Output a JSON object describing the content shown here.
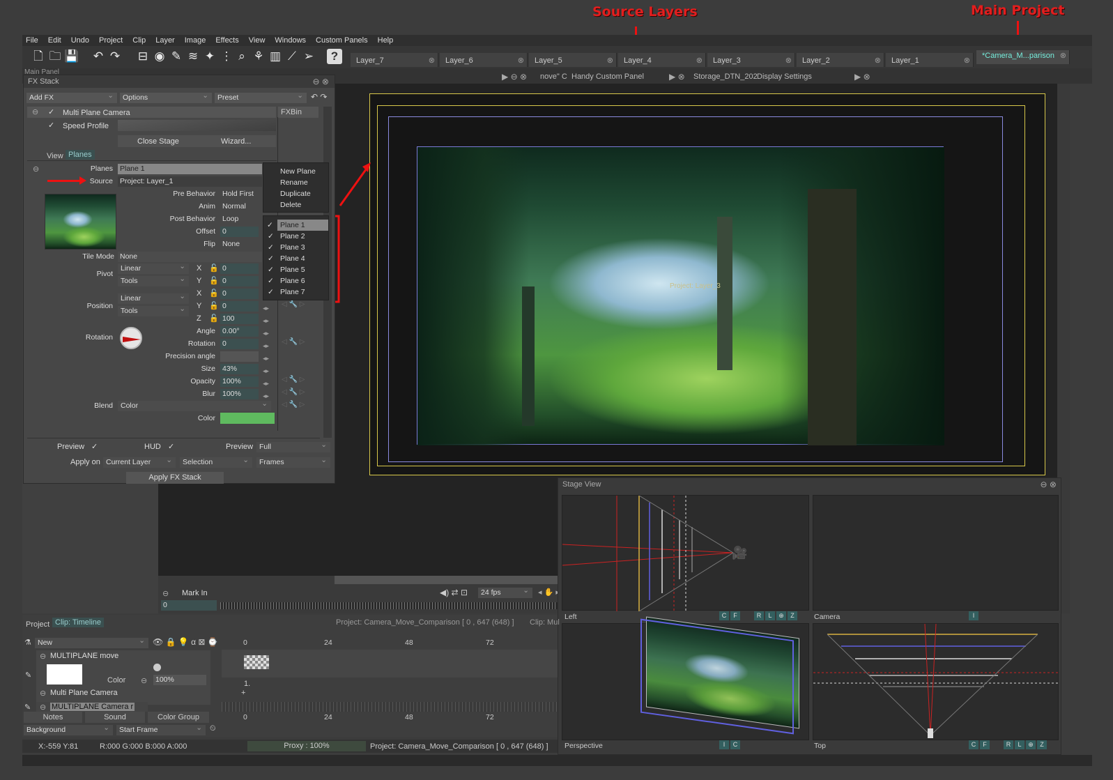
{
  "annotations": {
    "source_layers": "Source Layers",
    "main_project": "Main Project"
  },
  "menu": [
    "File",
    "Edit",
    "Undo",
    "Project",
    "Clip",
    "Layer",
    "Image",
    "Effects",
    "View",
    "Windows",
    "Custom Panels",
    "Help"
  ],
  "layer_tabs": [
    "Layer_7",
    "Layer_6",
    "Layer_5",
    "Layer_4",
    "Layer_3",
    "Layer_2",
    "Layer_1"
  ],
  "main_tab": "*Camera_M...parison",
  "panel_tabs": {
    "main_panel": "Main Panel",
    "move": "nove\" C",
    "handy": "Handy Custom Panel",
    "storage": "Storage_DTN_202",
    "display": "Display Settings"
  },
  "fx": {
    "title": "FX Stack",
    "add_fx": "Add FX",
    "options": "Options",
    "preset": "Preset",
    "effect": "Multi Plane Camera",
    "speed_profile": "Speed Profile",
    "fxbin": "FXBin",
    "close_stage": "Close Stage",
    "wizard": "Wizard...",
    "view_lbl": "View",
    "planes_tab": "Planes",
    "planes_lbl": "Planes",
    "planes_val": "Plane 1",
    "source_lbl": "Source",
    "source_val": "Project: Layer_1",
    "pre_behavior_lbl": "Pre Behavior",
    "pre_behavior_val": "Hold First",
    "anim_lbl": "Anim",
    "anim_val": "Normal",
    "post_behavior_lbl": "Post Behavior",
    "post_behavior_val": "Loop",
    "offset_lbl": "Offset",
    "offset_val": "0",
    "flip_lbl": "Flip",
    "flip_val": "None",
    "tile_lbl": "Tile Mode",
    "tile_val": "None",
    "pivot_lbl": "Pivot",
    "pivot_interp": "Linear",
    "pivot_tools": "Tools",
    "pivot_x": "0",
    "pivot_y": "0",
    "position_lbl": "Position",
    "pos_interp": "Linear",
    "pos_tools": "Tools",
    "pos_x": "0",
    "pos_y": "0",
    "pos_z": "100",
    "rotation_lbl": "Rotation",
    "angle_lbl": "Angle",
    "angle_val": "0.00°",
    "rot_lbl": "Rotation",
    "rot_val": "0",
    "precision_lbl": "Precision angle",
    "size_lbl": "Size",
    "size_val": "43%",
    "opacity_lbl": "Opacity",
    "opacity_val": "100%",
    "blur_lbl": "Blur",
    "blur_val": "100%",
    "blend_lbl": "Blend",
    "blend_val": "Color",
    "color_lbl": "Color",
    "color_swatch": "#5fba5f",
    "preview_lbl": "Preview",
    "hud_lbl": "HUD",
    "preview2_lbl": "Preview",
    "preview2_val": "Full",
    "apply_on_lbl": "Apply on",
    "apply_on_val": "Current Layer",
    "selection": "Selection",
    "frames": "Frames",
    "apply_btn": "Apply FX Stack",
    "axis_x": "X",
    "axis_y": "Y",
    "axis_z": "Z"
  },
  "plane_menu": {
    "actions": [
      "New Plane",
      "Rename",
      "Duplicate",
      "Delete"
    ],
    "planes": [
      "Plane 1",
      "Plane 2",
      "Plane 3",
      "Plane 4",
      "Plane 5",
      "Plane 6",
      "Plane 7"
    ]
  },
  "canvas": {
    "overlay_text": "Project: Layer_3"
  },
  "transport": {
    "mark_in": "Mark In",
    "frame": "0",
    "fps": "24 fps"
  },
  "stage": {
    "title": "Stage View",
    "left": "Left",
    "camera": "Camera",
    "perspective": "Perspective",
    "top": "Top"
  },
  "timeline": {
    "project_tab": "Project",
    "clip_tab": "Clip: Timeline",
    "info": "Project: Camera_Move_Comparison [ 0 , 647  (648) ]",
    "clip_info": "Clip: Mul",
    "new": "New",
    "layer1": "MULTIPLANE move",
    "color_lbl": "Color",
    "opacity": "100%",
    "effect": "Multi Plane Camera",
    "layer2": "MULTIPLANE Camera r",
    "notes": "Notes",
    "sound": "Sound",
    "color_group": "Color Group",
    "background": "Background",
    "start_frame": "Start Frame",
    "ticks": [
      "0",
      "24",
      "48",
      "72"
    ],
    "marker": "1."
  },
  "status": {
    "coords": "X:-559  Y:81",
    "rgba": "R:000 G:000 B:000 A:000",
    "proxy": "Proxy : 100%",
    "project": "Project: Camera_Move_Comparison [ 0 , 647  (648) ]"
  }
}
